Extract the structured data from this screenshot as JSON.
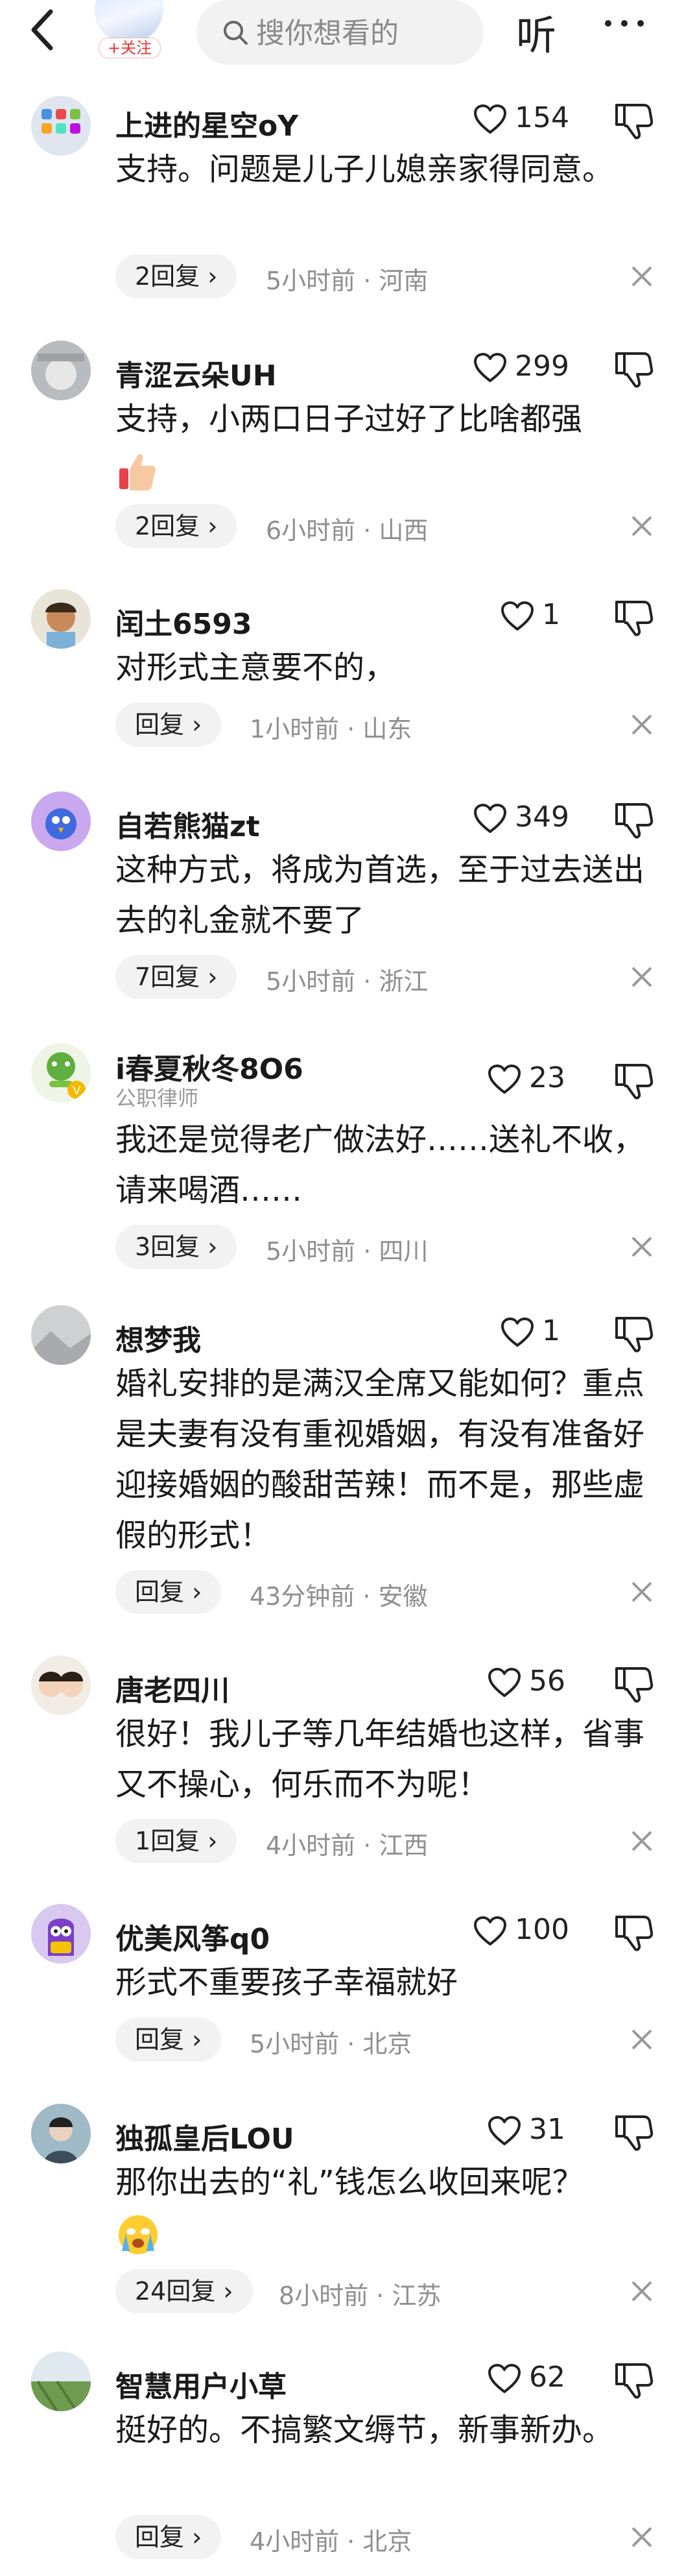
{
  "header": {
    "follow_label": "+关注",
    "search_placeholder": "搜你想看的",
    "listen_label": "听"
  },
  "comments": [
    {
      "name": "上进的星空oY",
      "likes": "154",
      "text": "支持。问题是儿子儿媳亲家得同意。",
      "replies": "2回复 ›",
      "meta": "5小时前 · 河南"
    },
    {
      "name": "青涩云朵UH",
      "likes": "299",
      "text": "支持，小两口日子过好了比啥都强",
      "emoji": "thumbs-up-emoji",
      "replies": "2回复 ›",
      "meta": "6小时前 · 山西"
    },
    {
      "name": "闰土6593",
      "likes": "1",
      "text": "对形式主意要不的，",
      "replies": "回复 ›",
      "meta": "1小时前 · 山东"
    },
    {
      "name": "自若熊猫zt",
      "likes": "349",
      "text": "这种方式，将成为首选，至于过去送出去的礼金就不要了",
      "replies": "7回复 ›",
      "meta": "5小时前 · 浙江"
    },
    {
      "name": "i春夏秋冬8O6",
      "subtitle": "公职律师",
      "likes": "23",
      "text": "我还是觉得老广做法好……送礼不收，请来喝酒……",
      "replies": "3回复 ›",
      "meta": "5小时前 · 四川"
    },
    {
      "name": "想梦我",
      "likes": "1",
      "text": "婚礼安排的是满汉全席又能如何？重点是夫妻有没有重视婚姻，有没有准备好迎接婚姻的酸甜苦辣！而不是，那些虚假的形式！",
      "replies": "回复 ›",
      "meta": "43分钟前 · 安徽"
    },
    {
      "name": "唐老四川",
      "likes": "56",
      "text": "很好！我儿子等几年结婚也这样，省事又不操心，何乐而不为呢！",
      "replies": "1回复 ›",
      "meta": "4小时前 · 江西"
    },
    {
      "name": "优美风筝q0",
      "likes": "100",
      "text": "形式不重要孩子幸福就好",
      "replies": "回复 ›",
      "meta": "5小时前 · 北京"
    },
    {
      "name": "独孤皇后LOU",
      "likes": "31",
      "text": "那你出去的“礼”钱怎么收回来呢？",
      "emoji": "crying-emoji",
      "replies": "24回复 ›",
      "meta": "8小时前 · 江苏"
    },
    {
      "name": "智慧用户小草",
      "likes": "62",
      "text": "挺好的。不搞繁文缛节，新事新办。",
      "replies": "回复 ›",
      "meta": "4小时前 · 北京"
    }
  ]
}
